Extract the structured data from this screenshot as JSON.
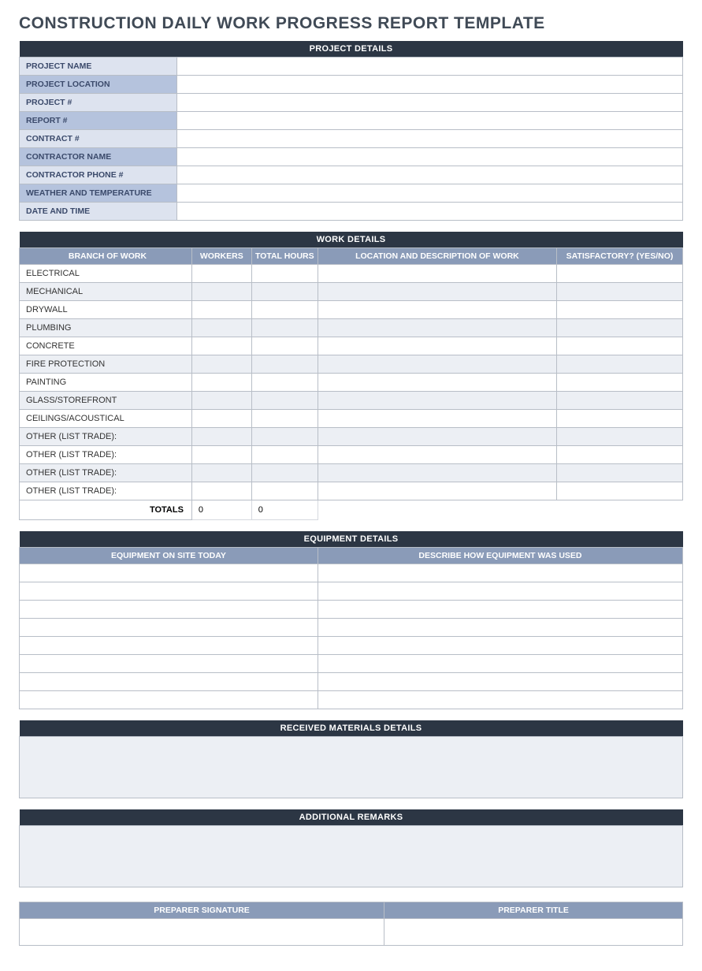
{
  "title": "CONSTRUCTION DAILY WORK PROGRESS REPORT TEMPLATE",
  "sections": {
    "project_details": {
      "header": "PROJECT DETAILS",
      "fields": [
        {
          "label": "PROJECT NAME",
          "value": ""
        },
        {
          "label": "PROJECT LOCATION",
          "value": ""
        },
        {
          "label": "PROJECT #",
          "value": ""
        },
        {
          "label": "REPORT #",
          "value": ""
        },
        {
          "label": "CONTRACT #",
          "value": ""
        },
        {
          "label": "CONTRACTOR NAME",
          "value": ""
        },
        {
          "label": "CONTRACTOR PHONE #",
          "value": ""
        },
        {
          "label": "WEATHER AND TEMPERATURE",
          "value": ""
        },
        {
          "label": "DATE AND TIME",
          "value": ""
        }
      ]
    },
    "work_details": {
      "header": "WORK DETAILS",
      "columns": [
        "BRANCH OF WORK",
        "WORKERS",
        "TOTAL HOURS",
        "LOCATION AND DESCRIPTION OF WORK",
        "SATISFACTORY? (YES/NO)"
      ],
      "rows": [
        {
          "branch": "ELECTRICAL",
          "workers": "",
          "hours": "",
          "location": "",
          "satisfactory": ""
        },
        {
          "branch": "MECHANICAL",
          "workers": "",
          "hours": "",
          "location": "",
          "satisfactory": ""
        },
        {
          "branch": "DRYWALL",
          "workers": "",
          "hours": "",
          "location": "",
          "satisfactory": ""
        },
        {
          "branch": "PLUMBING",
          "workers": "",
          "hours": "",
          "location": "",
          "satisfactory": ""
        },
        {
          "branch": "CONCRETE",
          "workers": "",
          "hours": "",
          "location": "",
          "satisfactory": ""
        },
        {
          "branch": "FIRE PROTECTION",
          "workers": "",
          "hours": "",
          "location": "",
          "satisfactory": ""
        },
        {
          "branch": "PAINTING",
          "workers": "",
          "hours": "",
          "location": "",
          "satisfactory": ""
        },
        {
          "branch": "GLASS/STOREFRONT",
          "workers": "",
          "hours": "",
          "location": "",
          "satisfactory": ""
        },
        {
          "branch": "CEILINGS/ACOUSTICAL",
          "workers": "",
          "hours": "",
          "location": "",
          "satisfactory": ""
        },
        {
          "branch": "OTHER (LIST TRADE):",
          "workers": "",
          "hours": "",
          "location": "",
          "satisfactory": ""
        },
        {
          "branch": "OTHER (LIST TRADE):",
          "workers": "",
          "hours": "",
          "location": "",
          "satisfactory": ""
        },
        {
          "branch": "OTHER (LIST TRADE):",
          "workers": "",
          "hours": "",
          "location": "",
          "satisfactory": ""
        },
        {
          "branch": "OTHER (LIST TRADE):",
          "workers": "",
          "hours": "",
          "location": "",
          "satisfactory": ""
        }
      ],
      "totals_label": "TOTALS",
      "totals_workers": "0",
      "totals_hours": "0"
    },
    "equipment_details": {
      "header": "EQUIPMENT DETAILS",
      "columns": [
        "EQUIPMENT ON SITE TODAY",
        "DESCRIBE HOW EQUIPMENT WAS USED"
      ],
      "row_count": 8
    },
    "received_materials": {
      "header": "RECEIVED MATERIALS DETAILS",
      "value": ""
    },
    "additional_remarks": {
      "header": "ADDITIONAL REMARKS",
      "value": ""
    },
    "signature": {
      "columns": [
        "PREPARER SIGNATURE",
        "PREPARER TITLE"
      ],
      "signature": "",
      "title": ""
    }
  }
}
